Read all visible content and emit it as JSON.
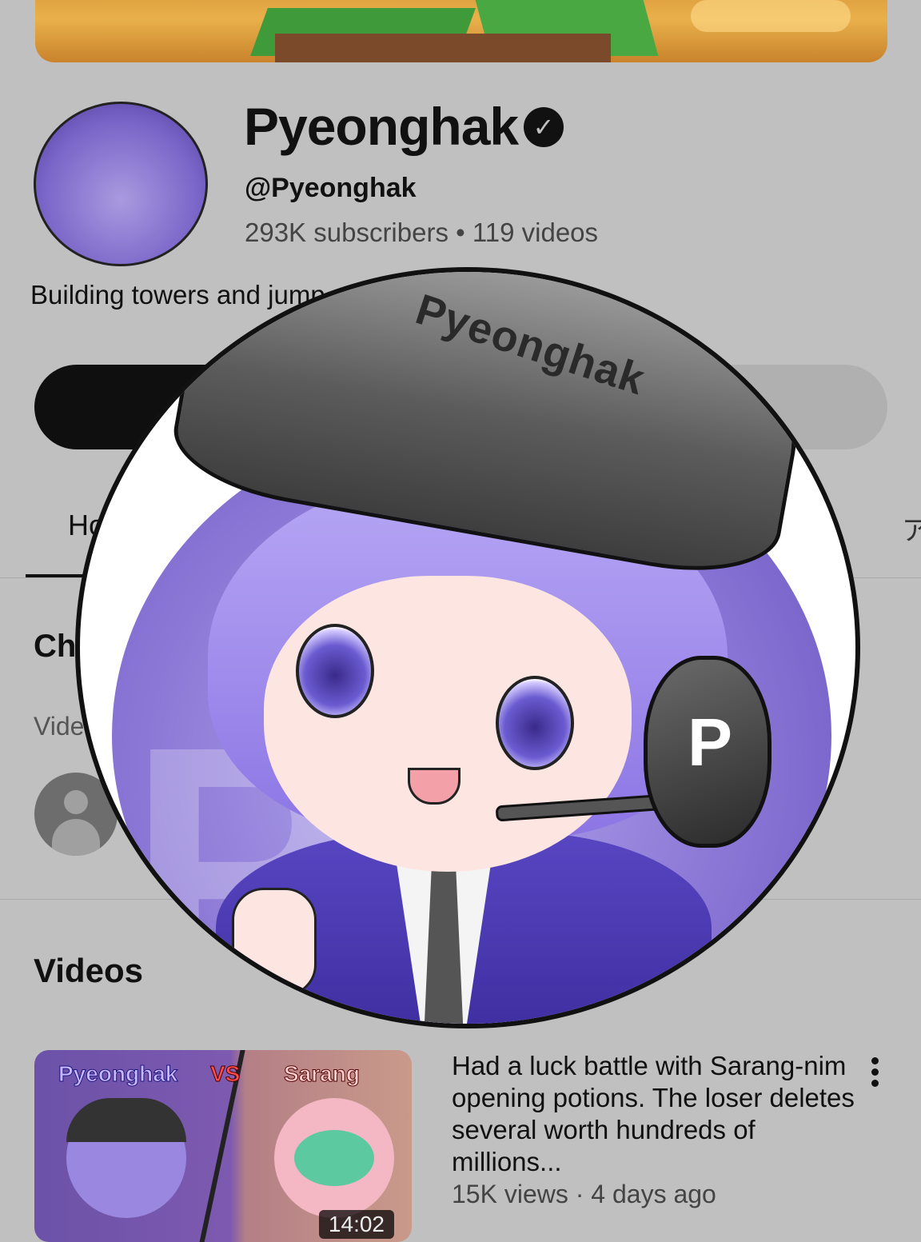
{
  "channel": {
    "name": "Pyeonghak",
    "verified_icon": "verified-check-icon",
    "handle": "@Pyeonghak",
    "stats": "293K subscribers • 119 videos",
    "description": "Building towers and jump",
    "avatar_cap_text": "Pyeonghak",
    "avatar_headphone_letter": "P"
  },
  "tabs": {
    "home_partial": "Ho",
    "more_partial": "ア"
  },
  "sections": {
    "channels_partial": "Ch",
    "videos_partial": "Vide",
    "videos_heading": "Videos"
  },
  "video": {
    "thumb_left_label": "Pyeonghak",
    "thumb_vs_label": "VS",
    "thumb_right_label": "Sarang",
    "duration": "14:02",
    "title": "Had a luck battle with Sarang-nim opening potions. The loser deletes several worth hundreds of millions...",
    "meta": "15K views · 4 days ago"
  },
  "colors": {
    "background": "#c0c0c0",
    "subscribe_button": "#0f0f0f",
    "avatar_purple": "#8b78d6"
  }
}
